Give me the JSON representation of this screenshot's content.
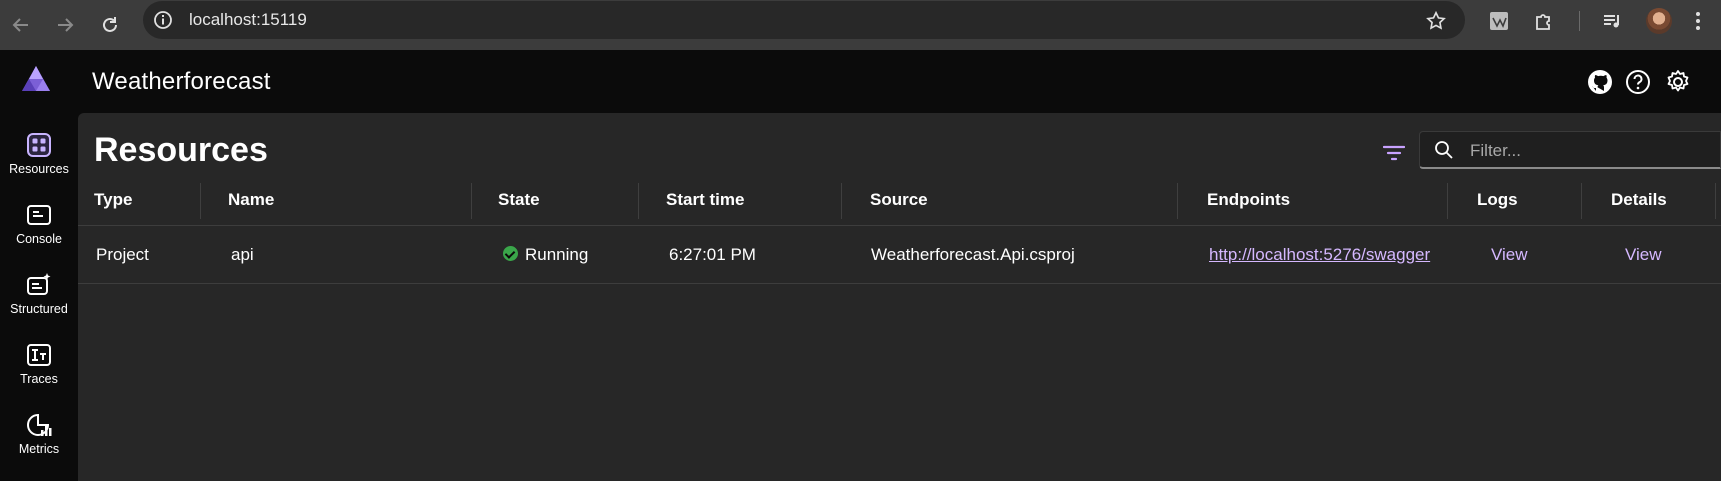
{
  "browser": {
    "url": "localhost:15119",
    "back_icon": "arrow-left-icon",
    "forward_icon": "arrow-right-icon",
    "reload_icon": "reload-icon"
  },
  "header": {
    "app_title": "Weatherforecast"
  },
  "sidebar": {
    "items": [
      {
        "label": "Resources",
        "icon": "resources-icon"
      },
      {
        "label": "Console",
        "icon": "console-icon"
      },
      {
        "label": "Structured",
        "icon": "structured-logs-icon"
      },
      {
        "label": "Traces",
        "icon": "traces-icon"
      },
      {
        "label": "Metrics",
        "icon": "metrics-icon"
      }
    ]
  },
  "main": {
    "title": "Resources",
    "search": {
      "placeholder": "Filter...",
      "value": ""
    }
  },
  "table": {
    "columns": [
      "Type",
      "Name",
      "State",
      "Start time",
      "Source",
      "Endpoints",
      "Logs",
      "Details"
    ],
    "rows": [
      {
        "type": "Project",
        "name": "api",
        "state": "Running",
        "start_time": "6:27:01 PM",
        "source": "Weatherforecast.Api.csproj",
        "endpoint": "http://localhost:5276/swagger",
        "logs": "View",
        "details": "View"
      }
    ]
  },
  "colors": {
    "accent": "#d5b8ff",
    "running": "#3aa64a",
    "panel": "#272727",
    "chrome": "#3c3c3c"
  }
}
